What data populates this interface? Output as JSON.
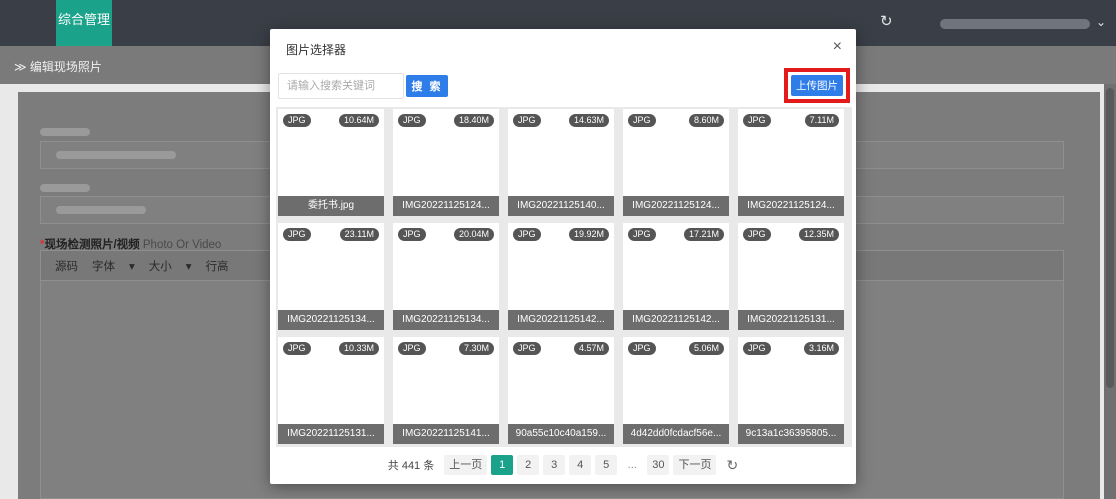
{
  "app": {
    "brand": "综合管理",
    "breadcrumb": "≫ 编辑现场照片"
  },
  "form": {
    "media_label": "现场检测照片/视频",
    "media_label_en": "Photo Or Video",
    "required_mark": "*",
    "editor_toolbar": [
      "源码",
      "字体",
      "▾",
      "大小",
      "▾",
      "行高"
    ]
  },
  "modal": {
    "title": "图片选择器",
    "close_glyph": "×",
    "search": {
      "placeholder": "请输入搜索关键词",
      "value": "",
      "button": "搜 索"
    },
    "upload_button": "上传图片",
    "images": [
      {
        "type": "JPG",
        "size": "10.64M",
        "name": "委托书.jpg"
      },
      {
        "type": "JPG",
        "size": "18.40M",
        "name": "IMG20221125124..."
      },
      {
        "type": "JPG",
        "size": "14.63M",
        "name": "IMG20221125140..."
      },
      {
        "type": "JPG",
        "size": "8.60M",
        "name": "IMG20221125124..."
      },
      {
        "type": "JPG",
        "size": "7.11M",
        "name": "IMG20221125124..."
      },
      {
        "type": "JPG",
        "size": "23.11M",
        "name": "IMG20221125134..."
      },
      {
        "type": "JPG",
        "size": "20.04M",
        "name": "IMG20221125134..."
      },
      {
        "type": "JPG",
        "size": "19.92M",
        "name": "IMG20221125142..."
      },
      {
        "type": "JPG",
        "size": "17.21M",
        "name": "IMG20221125142..."
      },
      {
        "type": "JPG",
        "size": "12.35M",
        "name": "IMG20221125131..."
      },
      {
        "type": "JPG",
        "size": "10.33M",
        "name": "IMG20221125131..."
      },
      {
        "type": "JPG",
        "size": "7.30M",
        "name": "IMG20221125141..."
      },
      {
        "type": "JPG",
        "size": "4.57M",
        "name": "90a55c10c40a159..."
      },
      {
        "type": "JPG",
        "size": "5.06M",
        "name": "4d42dd0fcdacf56e..."
      },
      {
        "type": "JPG",
        "size": "3.16M",
        "name": "9c13a1c36395805..."
      }
    ],
    "pager": {
      "total": "共 441 条",
      "prev": "上一页",
      "pages": [
        "1",
        "2",
        "3",
        "4",
        "5",
        "...",
        "30"
      ],
      "current": "1",
      "next": "下一页",
      "reload_glyph": "↻"
    }
  },
  "colors": {
    "accent": "#1aa28a",
    "primary_button": "#2f7de8",
    "highlight": "#e31b1b"
  }
}
